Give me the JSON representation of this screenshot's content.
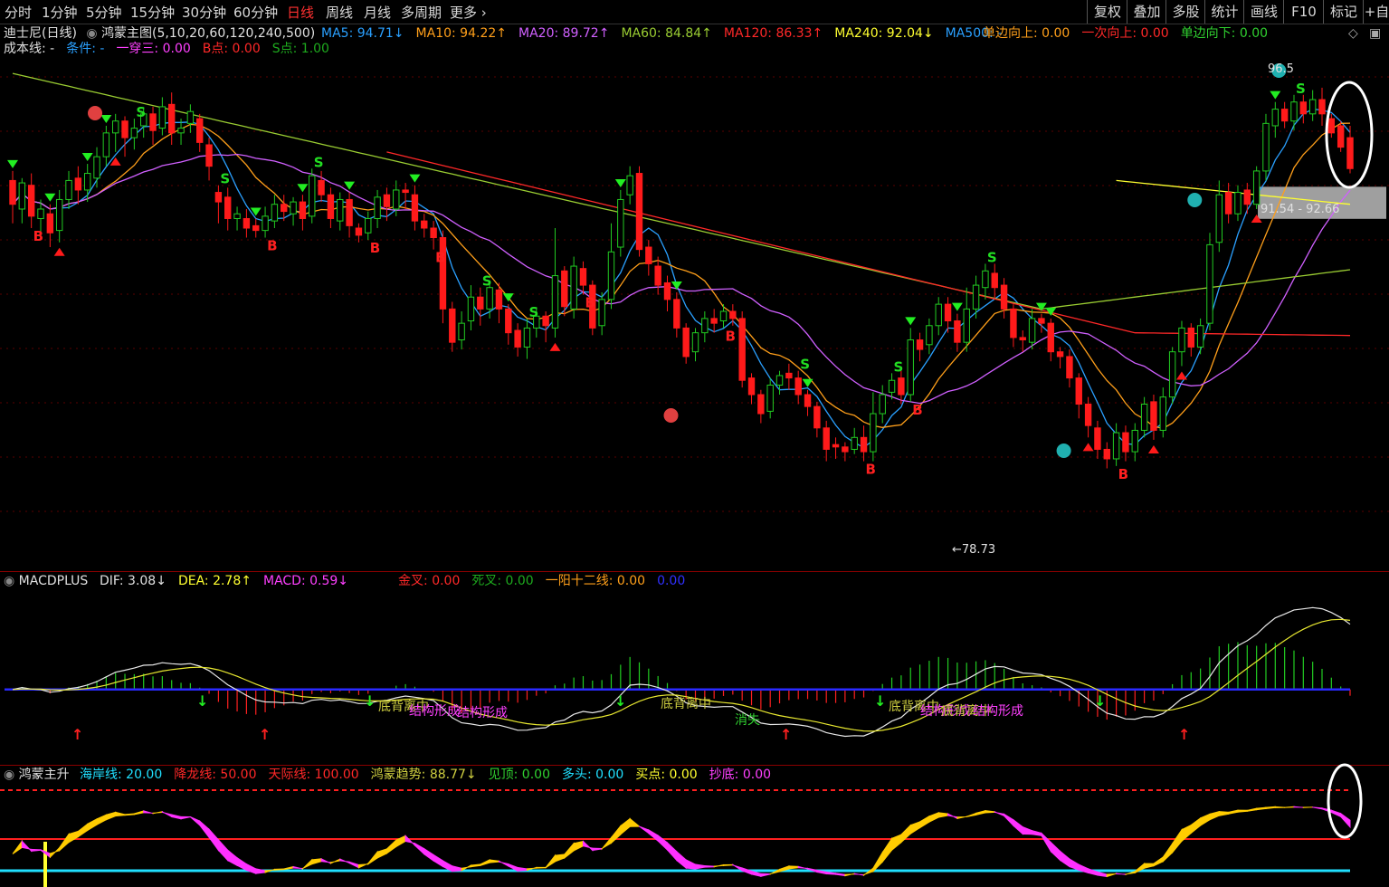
{
  "periods": [
    "分时",
    "1分钟",
    "5分钟",
    "15分钟",
    "30分钟",
    "60分钟",
    "日线",
    "周线",
    "月线",
    "多周期",
    "更多 ›"
  ],
  "active_period": "日线",
  "right_buttons": [
    "复权",
    "叠加",
    "多股",
    "统计",
    "画线",
    "F10",
    "标记",
    "+自"
  ],
  "main_panel": {
    "stock_title": "迪士尼(日线)",
    "indicator_name": "鸿蒙主图(5,10,20,60,120,240,500)",
    "ma": [
      {
        "label": "MA5: 94.71",
        "arrow": "↓",
        "color": "#2aa0ff"
      },
      {
        "label": "MA10: 94.22",
        "arrow": "↑",
        "color": "#ff9f1a"
      },
      {
        "label": "MA20: 89.72",
        "arrow": "↑",
        "color": "#d060ff"
      },
      {
        "label": "MA60: 84.84",
        "arrow": "↑",
        "color": "#9acd32"
      },
      {
        "label": "MA120: 86.33",
        "arrow": "↑",
        "color": "#ff2828"
      },
      {
        "label": "MA240: 92.04",
        "arrow": "↓",
        "color": "#ffff30"
      },
      {
        "label": "MA500: -",
        "arrow": "",
        "color": "#2aa0ff"
      }
    ],
    "signals_right": [
      {
        "label": "单边向上: 0.00",
        "color": "#ff9f1a"
      },
      {
        "label": "一次向上: 0.00",
        "color": "#ff2828"
      },
      {
        "label": "单边向下: 0.00",
        "color": "#30d030"
      }
    ],
    "line2": [
      {
        "label": "成本线: -",
        "color": "#e0e0e0"
      },
      {
        "label": "条件: -",
        "color": "#2aa0ff"
      },
      {
        "label": "一穿三: 0.00",
        "color": "#ff40ff"
      },
      {
        "label": "B点: 0.00",
        "color": "#ff2828"
      },
      {
        "label": "S点: 1.00",
        "color": "#1eaa1e"
      }
    ],
    "high_label": "96.5",
    "low_label": "←78.73",
    "range_label": "91.54 - 92.66"
  },
  "macd_panel": {
    "name": "MACDPLUS",
    "items": [
      {
        "label": "DIF: 3.08",
        "arrow": "↓",
        "color": "#e0e0e0"
      },
      {
        "label": "DEA: 2.78",
        "arrow": "↑",
        "color": "#ffff30"
      },
      {
        "label": "MACD: 0.59",
        "arrow": "↓",
        "color": "#ff40ff"
      },
      {
        "label": "金叉: 0.00",
        "arrow": "",
        "color": "#ff2828"
      },
      {
        "label": "死叉: 0.00",
        "arrow": "",
        "color": "#1eaa1e"
      },
      {
        "label": "一阳十二线: 0.00",
        "arrow": "",
        "color": "#ff9f1a"
      },
      {
        "label": "0.00",
        "arrow": "",
        "color": "#3030ff"
      }
    ],
    "annotations": [
      {
        "text": "底背离中",
        "color": "#cfcf40"
      },
      {
        "text": "结构形成",
        "color": "#ff40ff"
      },
      {
        "text": "结构形成",
        "color": "#ff40ff"
      },
      {
        "text": "底背离中",
        "color": "#cfcf40"
      },
      {
        "text": "消失",
        "color": "#30d030"
      },
      {
        "text": "底背离中",
        "color": "#cfcf40"
      },
      {
        "text": "结构形成",
        "color": "#ff40ff"
      },
      {
        "text": "底背离中",
        "color": "#cfcf40"
      },
      {
        "text": "结构形成",
        "color": "#ff40ff"
      }
    ]
  },
  "hm_panel": {
    "name": "鸿蒙主升",
    "items": [
      {
        "label": "海岸线: 20.00",
        "arrow": "",
        "color": "#20e0ff"
      },
      {
        "label": "降龙线: 50.00",
        "arrow": "",
        "color": "#ff2828"
      },
      {
        "label": "天际线: 100.00",
        "arrow": "",
        "color": "#ff2828"
      },
      {
        "label": "鸿蒙趋势: 88.77",
        "arrow": "↓",
        "color": "#cfcf40"
      },
      {
        "label": "见顶: 0.00",
        "arrow": "",
        "color": "#30d030"
      },
      {
        "label": "多头: 0.00",
        "arrow": "",
        "color": "#20e0ff"
      },
      {
        "label": "买点: 0.00",
        "arrow": "",
        "color": "#ffff30"
      },
      {
        "label": "抄底: 0.00",
        "arrow": "",
        "color": "#ff40ff"
      }
    ]
  },
  "chart_data": {
    "type": "candlestick",
    "ylim": [
      77,
      98
    ],
    "candles": [
      [
        93.0,
        92.0,
        91.2,
        93.4
      ],
      [
        91.8,
        92.9,
        91.2,
        93.1
      ],
      [
        92.8,
        91.5,
        91.0,
        93.3
      ],
      [
        91.4,
        91.8,
        90.6,
        92.2
      ],
      [
        91.6,
        90.8,
        90.2,
        92.0
      ],
      [
        90.9,
        92.2,
        90.4,
        92.6
      ],
      [
        92.2,
        93.0,
        91.8,
        93.4
      ],
      [
        93.1,
        92.6,
        92.0,
        93.6
      ],
      [
        92.6,
        93.3,
        92.1,
        93.7
      ],
      [
        93.1,
        94.0,
        92.7,
        94.4
      ],
      [
        94.0,
        95.0,
        93.6,
        95.3
      ],
      [
        95.0,
        95.5,
        94.2,
        95.8
      ],
      [
        95.5,
        94.8,
        94.0,
        95.7
      ],
      [
        94.8,
        95.2,
        94.3,
        95.6
      ],
      [
        95.3,
        95.8,
        94.8,
        96.0
      ],
      [
        95.8,
        95.1,
        94.5,
        96.1
      ],
      [
        95.2,
        96.1,
        94.9,
        96.5
      ],
      [
        96.2,
        95.0,
        94.5,
        96.7
      ],
      [
        95.0,
        95.2,
        94.5,
        95.6
      ],
      [
        95.4,
        95.9,
        95.0,
        96.2
      ],
      [
        95.6,
        94.6,
        94.2,
        95.8
      ],
      [
        94.5,
        93.6,
        93.0,
        94.8
      ],
      [
        92.5,
        92.1,
        91.2,
        92.8
      ],
      [
        92.3,
        91.4,
        90.9,
        92.7
      ],
      [
        91.4,
        91.6,
        90.9,
        91.9
      ],
      [
        91.4,
        91.0,
        90.6,
        91.8
      ],
      [
        91.1,
        90.9,
        90.6,
        91.4
      ],
      [
        90.9,
        91.5,
        90.6,
        91.9
      ],
      [
        91.3,
        92.0,
        91.0,
        92.4
      ],
      [
        92.0,
        91.7,
        91.3,
        92.4
      ],
      [
        91.6,
        92.1,
        91.1,
        92.3
      ],
      [
        92.1,
        91.4,
        90.9,
        92.4
      ],
      [
        91.5,
        93.2,
        91.2,
        93.5
      ],
      [
        93.0,
        92.4,
        92.1,
        93.4
      ],
      [
        92.4,
        91.4,
        91.0,
        92.7
      ],
      [
        91.3,
        92.2,
        90.9,
        92.5
      ],
      [
        92.2,
        91.1,
        90.6,
        92.5
      ],
      [
        91.0,
        90.7,
        90.4,
        91.2
      ],
      [
        90.8,
        91.4,
        90.5,
        91.7
      ],
      [
        91.4,
        92.3,
        91.0,
        92.6
      ],
      [
        92.4,
        91.9,
        91.3,
        92.7
      ],
      [
        91.8,
        92.6,
        91.5,
        93.0
      ],
      [
        92.6,
        92.5,
        91.8,
        92.9
      ],
      [
        92.4,
        91.3,
        90.9,
        92.8
      ],
      [
        91.3,
        91.0,
        90.6,
        91.6
      ],
      [
        91.0,
        90.6,
        90.1,
        91.3
      ],
      [
        90.6,
        87.6,
        87.0,
        90.9
      ],
      [
        87.6,
        86.2,
        85.8,
        87.9
      ],
      [
        86.3,
        87.0,
        85.9,
        87.5
      ],
      [
        87.1,
        88.1,
        86.7,
        88.6
      ],
      [
        88.1,
        87.6,
        86.9,
        88.5
      ],
      [
        87.6,
        88.5,
        87.2,
        88.8
      ],
      [
        88.4,
        87.6,
        87.0,
        88.7
      ],
      [
        87.6,
        86.6,
        86.1,
        87.8
      ],
      [
        86.7,
        86.0,
        85.6,
        87.0
      ],
      [
        86.0,
        86.8,
        85.5,
        87.2
      ],
      [
        86.8,
        87.3,
        86.4,
        87.6
      ],
      [
        87.3,
        86.9,
        86.2,
        87.5
      ],
      [
        86.8,
        89.0,
        86.4,
        91.0
      ],
      [
        89.2,
        87.7,
        87.3,
        89.4
      ],
      [
        87.6,
        89.4,
        87.2,
        89.8
      ],
      [
        89.3,
        88.6,
        88.2,
        89.6
      ],
      [
        88.6,
        86.8,
        86.5,
        88.8
      ],
      [
        86.9,
        88.0,
        86.5,
        88.3
      ],
      [
        88.0,
        90.0,
        87.6,
        91.2
      ],
      [
        90.2,
        92.2,
        89.8,
        92.6
      ],
      [
        92.4,
        93.2,
        92.0,
        93.6
      ],
      [
        93.3,
        90.1,
        89.8,
        93.6
      ],
      [
        90.2,
        89.5,
        89.0,
        90.5
      ],
      [
        89.4,
        88.6,
        88.2,
        89.8
      ],
      [
        88.7,
        88.0,
        87.5,
        89.0
      ],
      [
        88.0,
        86.8,
        86.4,
        88.3
      ],
      [
        86.8,
        85.6,
        85.3,
        87.0
      ],
      [
        85.8,
        86.6,
        85.4,
        86.8
      ],
      [
        86.6,
        87.2,
        86.2,
        87.5
      ],
      [
        87.2,
        87.0,
        86.6,
        87.6
      ],
      [
        87.1,
        87.5,
        86.8,
        87.8
      ],
      [
        87.5,
        87.2,
        86.9,
        87.8
      ],
      [
        87.2,
        84.6,
        84.3,
        87.5
      ],
      [
        84.7,
        84.0,
        83.6,
        84.9
      ],
      [
        84.0,
        83.2,
        82.8,
        84.2
      ],
      [
        83.3,
        84.4,
        83.0,
        84.7
      ],
      [
        84.4,
        84.8,
        84.0,
        85.0
      ],
      [
        84.9,
        84.7,
        84.2,
        85.3
      ],
      [
        84.7,
        84.0,
        83.6,
        85.0
      ],
      [
        84.0,
        83.5,
        83.1,
        84.2
      ],
      [
        83.5,
        82.6,
        82.2,
        83.7
      ],
      [
        82.6,
        81.7,
        81.2,
        82.9
      ],
      [
        81.9,
        81.8,
        81.3,
        82.2
      ],
      [
        81.8,
        81.6,
        81.2,
        82.0
      ],
      [
        81.7,
        82.2,
        81.5,
        82.6
      ],
      [
        82.2,
        81.6,
        81.2,
        82.7
      ],
      [
        81.6,
        83.2,
        81.2,
        84.1
      ],
      [
        83.2,
        84.0,
        82.8,
        84.4
      ],
      [
        84.1,
        84.6,
        83.8,
        84.9
      ],
      [
        84.7,
        84.0,
        83.6,
        85.0
      ],
      [
        84.0,
        86.3,
        83.7,
        86.8
      ],
      [
        86.3,
        85.9,
        85.4,
        86.6
      ],
      [
        86.1,
        86.9,
        85.7,
        87.2
      ],
      [
        86.9,
        87.8,
        86.5,
        88.1
      ],
      [
        87.8,
        87.1,
        86.6,
        88.1
      ],
      [
        87.1,
        86.2,
        85.8,
        87.4
      ],
      [
        86.2,
        87.6,
        85.8,
        88.5
      ],
      [
        87.6,
        88.6,
        87.2,
        89.0
      ],
      [
        88.5,
        89.2,
        88.0,
        89.5
      ],
      [
        89.1,
        88.5,
        88.0,
        89.5
      ],
      [
        88.6,
        87.6,
        87.2,
        88.9
      ],
      [
        87.6,
        86.4,
        86.0,
        87.8
      ],
      [
        86.4,
        86.3,
        85.8,
        86.7
      ],
      [
        86.2,
        87.2,
        85.9,
        87.6
      ],
      [
        87.2,
        87.0,
        86.6,
        87.4
      ],
      [
        87.0,
        85.8,
        85.4,
        87.2
      ],
      [
        85.8,
        85.6,
        85.1,
        86.0
      ],
      [
        85.6,
        84.7,
        84.3,
        85.9
      ],
      [
        84.7,
        83.6,
        83.0,
        84.9
      ],
      [
        83.6,
        82.7,
        82.2,
        83.9
      ],
      [
        82.6,
        81.7,
        81.3,
        82.9
      ],
      [
        81.7,
        81.3,
        80.9,
        82.0
      ],
      [
        81.3,
        82.4,
        81.0,
        82.8
      ],
      [
        82.4,
        81.6,
        81.2,
        82.7
      ],
      [
        81.6,
        82.5,
        81.2,
        82.8
      ],
      [
        82.5,
        83.6,
        82.2,
        83.9
      ],
      [
        83.7,
        82.5,
        82.1,
        84.0
      ],
      [
        82.5,
        83.9,
        82.2,
        84.3
      ],
      [
        83.9,
        85.8,
        83.6,
        86.0
      ],
      [
        85.8,
        86.8,
        85.2,
        87.1
      ],
      [
        86.8,
        86.0,
        85.6,
        87.0
      ],
      [
        86.0,
        86.9,
        85.7,
        87.2
      ],
      [
        87.0,
        90.3,
        86.7,
        90.8
      ],
      [
        90.4,
        92.4,
        90.0,
        93.0
      ],
      [
        92.5,
        91.6,
        91.2,
        92.9
      ],
      [
        91.6,
        92.5,
        91.3,
        92.8
      ],
      [
        92.6,
        92.0,
        91.6,
        92.9
      ],
      [
        92.0,
        93.4,
        91.8,
        93.6
      ],
      [
        93.4,
        95.4,
        93.0,
        95.8
      ],
      [
        95.3,
        96.0,
        94.8,
        96.3
      ],
      [
        96.0,
        95.5,
        95.2,
        96.3
      ],
      [
        95.5,
        96.3,
        95.1,
        96.6
      ],
      [
        96.3,
        95.8,
        95.4,
        96.6
      ],
      [
        95.8,
        96.4,
        95.5,
        96.8
      ],
      [
        96.4,
        95.8,
        95.3,
        96.9
      ],
      [
        95.6,
        95.0,
        94.8,
        95.8
      ],
      [
        95.3,
        94.4,
        94.2,
        95.5
      ],
      [
        94.8,
        93.5,
        93.3,
        95.3
      ]
    ],
    "ma_lines": [
      {
        "name": "MA5",
        "color": "#2aa0ff"
      },
      {
        "name": "MA10",
        "color": "#ff9f1a"
      },
      {
        "name": "MA20",
        "color": "#d060ff"
      },
      {
        "name": "MA60",
        "color": "#9acd32"
      },
      {
        "name": "MA120",
        "color": "#ff2828"
      },
      {
        "name": "MA240",
        "color": "#ffff30"
      }
    ],
    "macd_ylim": [
      -2.5,
      3.5
    ],
    "hm_ylim": [
      0,
      100
    ]
  }
}
